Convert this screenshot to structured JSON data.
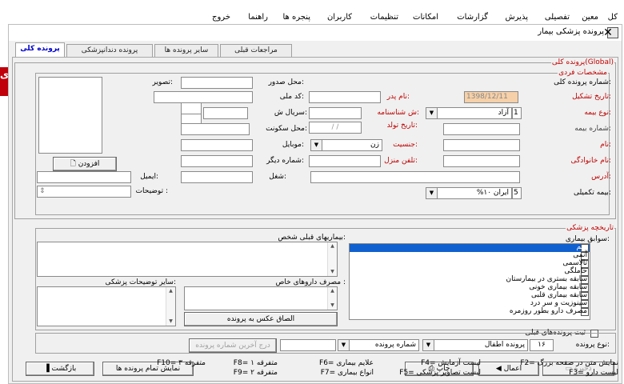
{
  "menu": {
    "items": [
      "کل",
      "معین",
      "تفصیلی",
      "پذیرش",
      "گزارشات",
      "امکانات",
      "تنظیمات",
      "کاربران",
      "پنجره ها",
      "راهنما",
      "خروج"
    ]
  },
  "side_text": "ی",
  "window": {
    "title": "پرونده پزشکی بیمار",
    "close": "✕"
  },
  "tabs": [
    "پرونده کلی",
    "پرونده دندانپزشکی",
    "سایر پرونده ها",
    "مراجعات قبلی"
  ],
  "general": {
    "legend": "پرونده کلی(Global)",
    "personal_legend": "مشخصات فردی",
    "file_no_label": "شماره پرونده کلی:",
    "created_label": "تاریخ تشکیل:",
    "created_value": "1398/12/11",
    "insurance_type_label": "نوع بیمه:",
    "insurance_type_code": "1",
    "insurance_type_value": "آزاد",
    "insurance_no_label": "شماره بیمه:",
    "first_name_label": "نام:",
    "last_name_label": "نام خانوادگی:",
    "address_label": "آدرس:",
    "supp_ins_label": "بیمه تکمیلی:",
    "supp_ins_code": "5",
    "supp_ins_value": "ایران ۱۰%",
    "father_label": "نام پدر:",
    "id_no_label": "ش شناسنامه:",
    "birth_label": "تاریخ تولد:",
    "birth_value": "/ /",
    "gender_label": "جنسیت:",
    "gender_value": "زن",
    "home_tel_label": "تلفن منزل:",
    "place_issue_label": "محل صدور:",
    "national_code_label": "کد ملی:",
    "serial_label": "سریال ش:",
    "residence_label": "محل سکونت:",
    "mobile_label": "موبایل:",
    "other_no_label": "شماره دیگر:",
    "job_label": "شغل:",
    "photo_label": "تصویر:",
    "add_label": "افزودن",
    "email_label": "ایمیل:",
    "desc_label": "توضیحات :"
  },
  "history": {
    "legend": "تاریخچه پزشکی",
    "records_label": "سوابق بیماری:",
    "items": [
      "سم",
      "آنمی",
      "تالاسمی",
      "حاملگی",
      "سابقه بستری در بیمارستان",
      "سابقه بیماری خونی",
      "سابقه بیماری قلبی",
      "سینوزیت و سر درد",
      "مصرف دارو بطور روزمره"
    ],
    "prev_diseases_label": "بیماریهای قبلی شخص:",
    "special_drugs_label": "مصرف داروهای خاص :",
    "other_desc_label": "سایر توضیحات پزشکی:",
    "attach_photo_label": "الصاق عکس به پرونده"
  },
  "prev_files": {
    "register_label": "ثبت پرونده‌های قبلی",
    "file_type_label": "نوع پرونده:",
    "file_type_code": "۱۶",
    "file_type_value": "پرونده اطفال",
    "file_no_label": "شماره پرونده",
    "insert_last_label": "درج آخرین شماره پرونده"
  },
  "buttons": {
    "save": "ذخیره",
    "apply": "اعمال",
    "print": "چاپ",
    "show_all": "نمایش تمام پرونده ها",
    "back": "بازگشت"
  },
  "status": {
    "f2": "F2= نمایش متن در صفحه بزرگ",
    "f3": "F3= لیست دارو",
    "f4": "F4= لیست آزمایش",
    "f5": "F5= لیست تصاویر پزشکی",
    "f6": "F6= علایم بیماری",
    "f7": "F7= انواع بیماری",
    "f8": "F8= متفرقه ۱",
    "f9": "F9= متفرقه ۲",
    "f10": "F10= متفرقه ۳"
  }
}
